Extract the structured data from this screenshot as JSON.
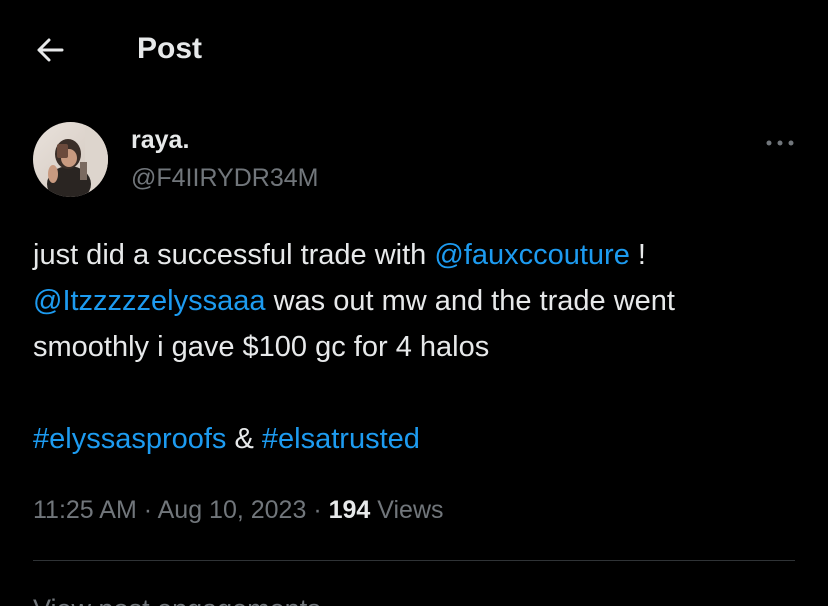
{
  "header": {
    "title": "Post",
    "back_icon": "arrow-left-icon"
  },
  "author": {
    "display_name": "raya.",
    "handle": "@F4IIRYDR34M",
    "avatar_icon": "avatar-photo"
  },
  "tweet": {
    "line1": {
      "text_before": "just did a successful trade with ",
      "mention": "@fauxccouture",
      "text_after": " !"
    },
    "line2": {
      "mention": "@Itzzzzzelyssaaa",
      "text_after": " was out mw and the trade went"
    },
    "line3": "smoothly i gave $100 gc for 4 halos",
    "hashtags": {
      "first": "#elyssasproofs",
      "separator": " & ",
      "second": "#elsatrusted"
    }
  },
  "meta": {
    "time": "11:25 AM",
    "dot1": " · ",
    "date": "Aug 10, 2023",
    "dot2": " · ",
    "views_count": "194",
    "views_label": " Views"
  },
  "engagements": {
    "label": "View post engagements"
  },
  "colors": {
    "background": "#000000",
    "link": "#1d9bf0",
    "text": "#e7e9ea",
    "muted": "#71767b",
    "divider": "#2f3336"
  }
}
